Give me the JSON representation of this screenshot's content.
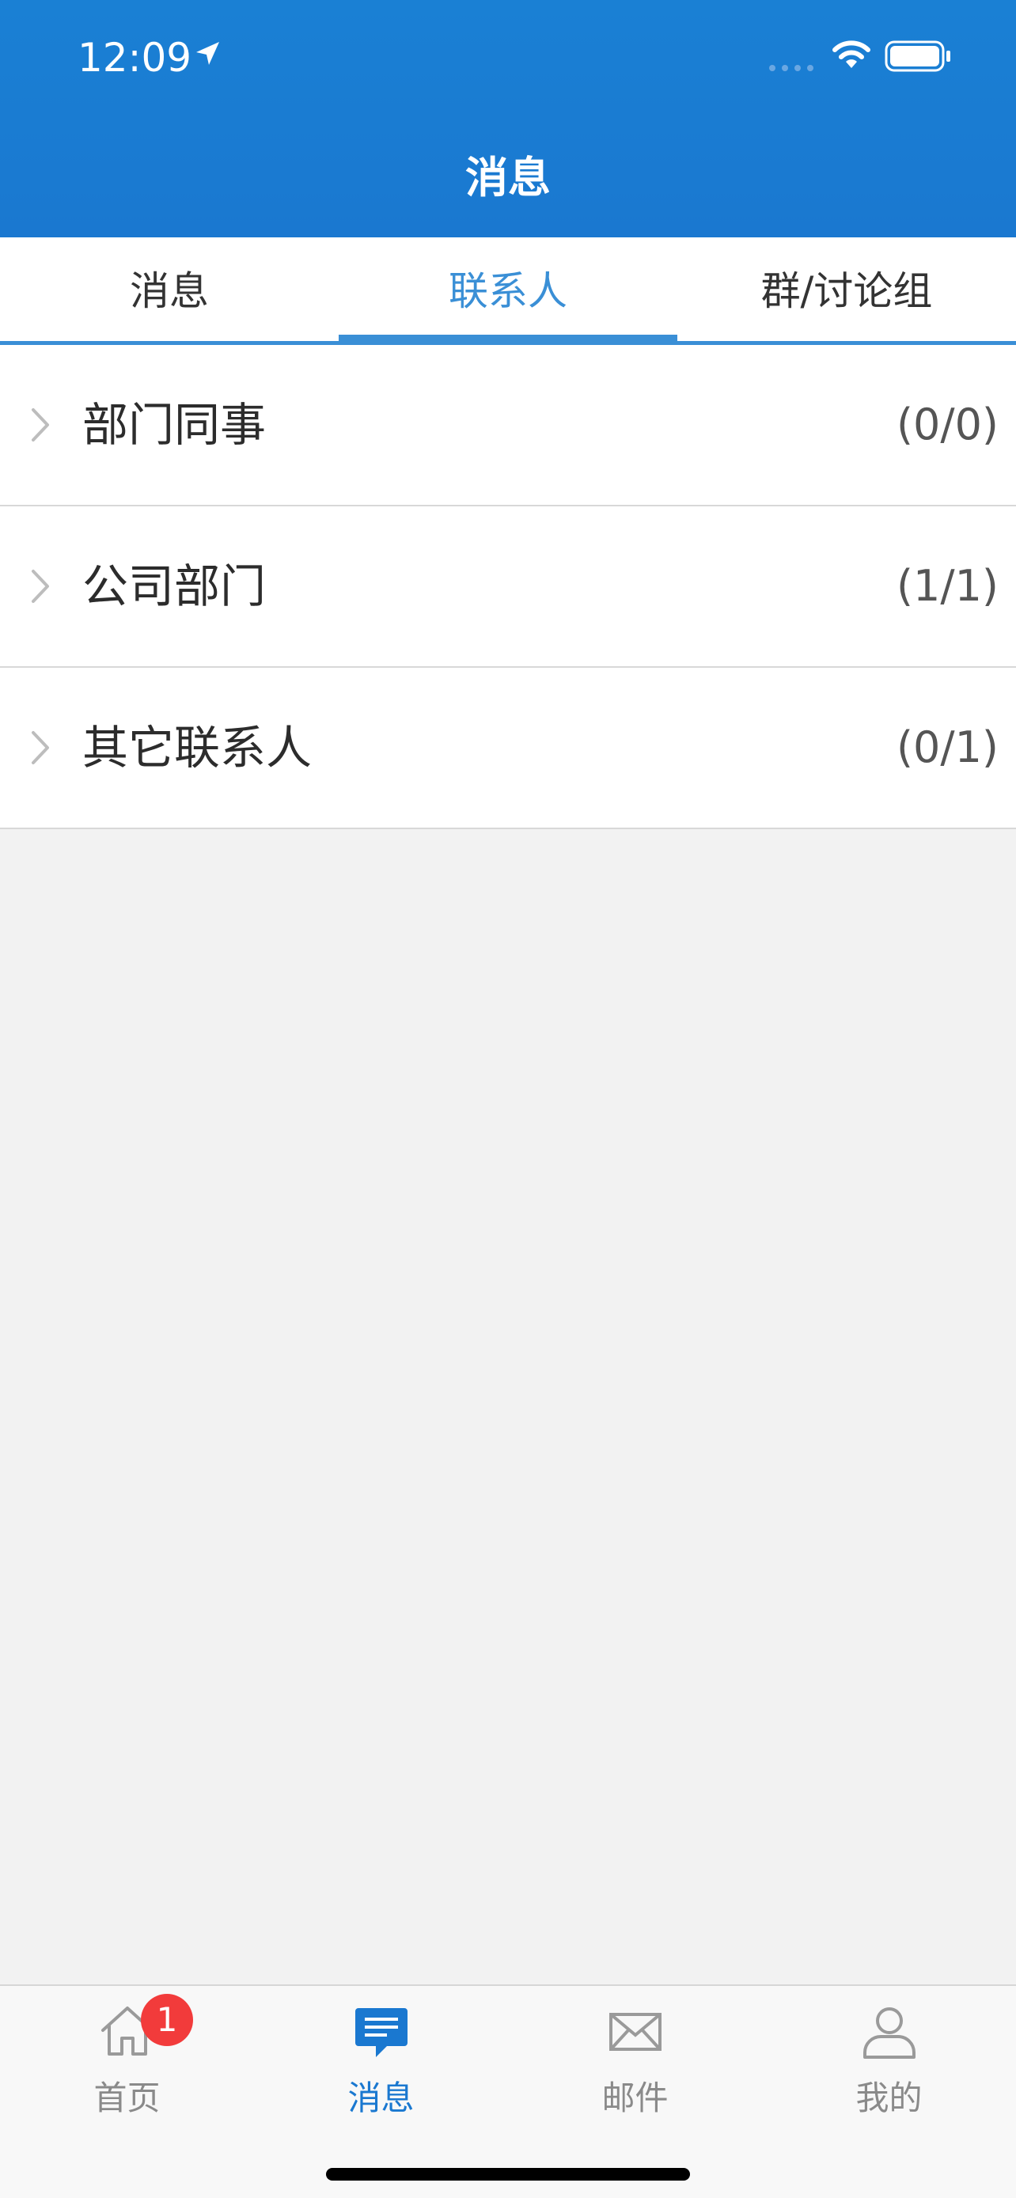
{
  "status_bar": {
    "time": "12:09"
  },
  "header": {
    "title": "消息"
  },
  "tabs": [
    {
      "label": "消息",
      "active": false
    },
    {
      "label": "联系人",
      "active": true
    },
    {
      "label": "群/讨论组",
      "active": false
    }
  ],
  "contact_groups": [
    {
      "label": "部门同事",
      "count": "(0/0)"
    },
    {
      "label": "公司部门",
      "count": "(1/1)"
    },
    {
      "label": "其它联系人",
      "count": "(0/1)"
    }
  ],
  "tabbar": {
    "items": [
      {
        "label": "首页",
        "icon": "home-icon",
        "badge": "1",
        "active": false
      },
      {
        "label": "消息",
        "icon": "message-icon",
        "active": true
      },
      {
        "label": "邮件",
        "icon": "mail-icon",
        "active": false
      },
      {
        "label": "我的",
        "icon": "profile-icon",
        "active": false
      }
    ]
  },
  "colors": {
    "header_blue": "#1a78d0",
    "accent": "#3a8fd6",
    "badge_red": "#f23b3b",
    "background": "#f2f2f2"
  }
}
